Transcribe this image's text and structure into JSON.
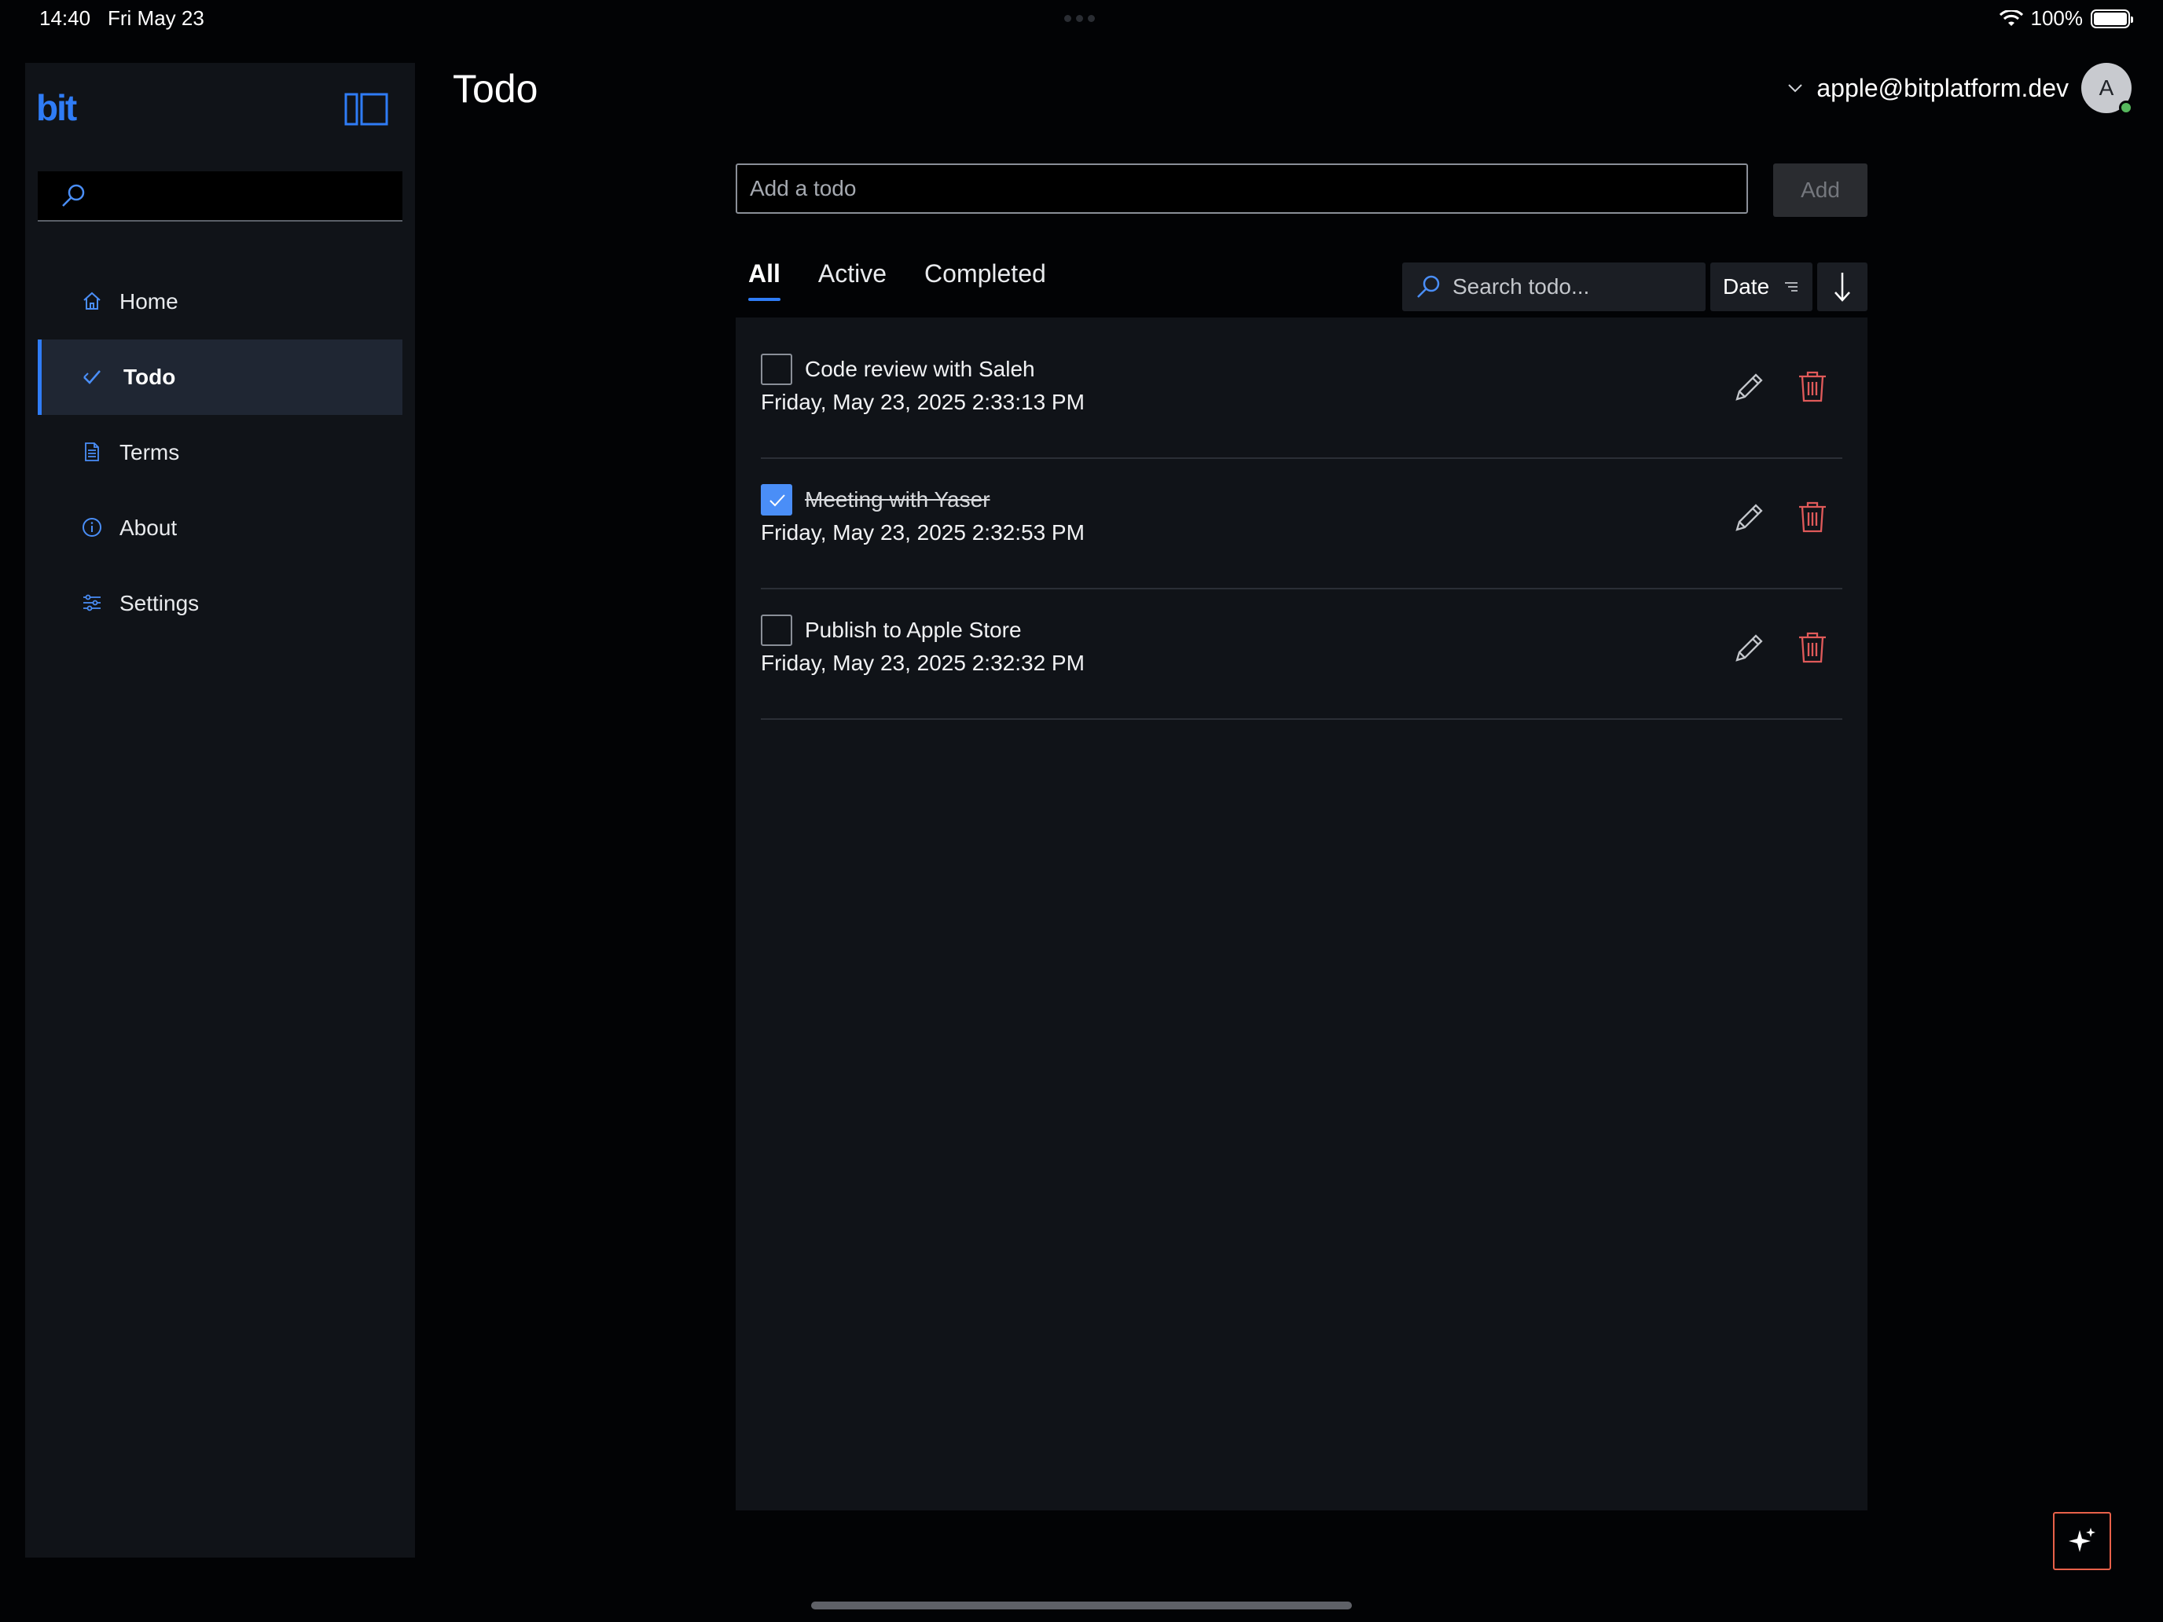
{
  "status_bar": {
    "time": "14:40",
    "date": "Fri May 23",
    "battery": "100%",
    "battery_level_percent": 100
  },
  "sidebar": {
    "logo": "bit",
    "search_placeholder": "",
    "items": [
      {
        "label": "Home",
        "icon": "home-icon",
        "active": false
      },
      {
        "label": "Todo",
        "icon": "checkmark-icon",
        "active": true
      },
      {
        "label": "Terms",
        "icon": "document-icon",
        "active": false
      },
      {
        "label": "About",
        "icon": "info-icon",
        "active": false
      },
      {
        "label": "Settings",
        "icon": "sliders-icon",
        "active": false
      }
    ]
  },
  "header": {
    "title": "Todo",
    "user_email": "apple@bitplatform.dev",
    "avatar_initial": "A",
    "online": true
  },
  "add_todo": {
    "placeholder": "Add a todo",
    "value": "",
    "button_label": "Add",
    "button_disabled": true
  },
  "tabs": [
    {
      "label": "All",
      "active": true
    },
    {
      "label": "Active",
      "active": false
    },
    {
      "label": "Completed",
      "active": false
    }
  ],
  "toolbar": {
    "search_placeholder": "Search todo...",
    "sort_field": "Date",
    "sort_direction": "descending"
  },
  "todos": [
    {
      "title": "Code review with Saleh",
      "date": "Friday, May 23, 2025 2:33:13 PM",
      "completed": false
    },
    {
      "title": "Meeting with Yaser",
      "date": "Friday, May 23, 2025 2:32:53 PM",
      "completed": true
    },
    {
      "title": "Publish to Apple Store",
      "date": "Friday, May 23, 2025 2:32:32 PM",
      "completed": false
    }
  ],
  "colors": {
    "accent": "#2f7cf6",
    "checkbox_checked": "#4a8ef7",
    "delete": "#e05a5a",
    "sparkle_border": "#e8614a",
    "online": "#56b85d"
  }
}
